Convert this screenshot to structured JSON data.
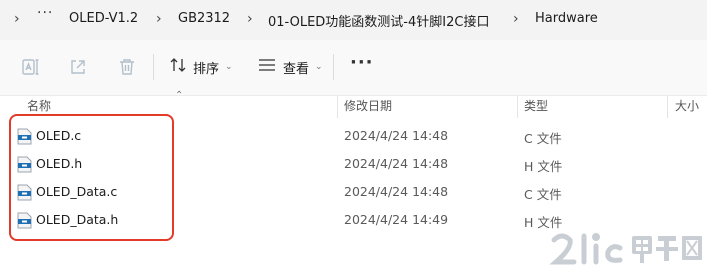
{
  "breadcrumb": {
    "items": [
      "OLED-V1.2",
      "GB2312",
      "01-OLED功能函数测试-4针脚I2C接口",
      "Hardware"
    ],
    "more_label": "···"
  },
  "toolbar": {
    "sort_label": "排序",
    "view_label": "查看",
    "more_label": "···"
  },
  "columns": {
    "name": "名称",
    "modified": "修改日期",
    "type": "类型",
    "size": "大小"
  },
  "files": [
    {
      "name": "OLED.c",
      "modified": "2024/4/24 14:48",
      "type": "C 文件"
    },
    {
      "name": "OLED.h",
      "modified": "2024/4/24 14:48",
      "type": "H 文件"
    },
    {
      "name": "OLED_Data.c",
      "modified": "2024/4/24 14:48",
      "type": "C 文件"
    },
    {
      "name": "OLED_Data.h",
      "modified": "2024/4/24 14:49",
      "type": "H 文件"
    }
  ],
  "watermark": {
    "text": "21ic 电子网"
  },
  "colors": {
    "highlight": "#e23b2a",
    "breadcrumb_bg": "#f3f3f3",
    "toolbar_bg": "#f9f9f9",
    "file_icon_blue": "#1f6fb5",
    "watermark": "#c9ced4"
  },
  "icons": {
    "toolbar": [
      "rename-icon",
      "share-icon",
      "delete-icon",
      "sort-icon",
      "view-icon"
    ],
    "file": "source-file-icon"
  }
}
